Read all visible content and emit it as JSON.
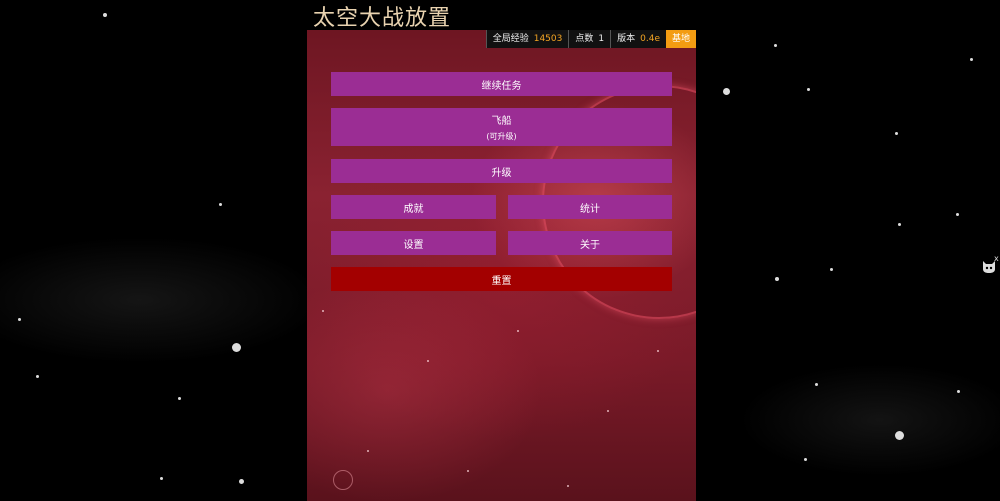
{
  "title": "太空大战放置",
  "topbar": {
    "global_xp_label": "全局经验",
    "global_xp_value": "14503",
    "points_label": "点数",
    "points_value": "1",
    "version_label": "版本",
    "version_value": "0.4e",
    "base_label": "基地"
  },
  "menu": {
    "continue_mission": "继续任务",
    "ship": "飞船",
    "ship_sub": "(可升级)",
    "upgrade": "升级",
    "achievements": "成就",
    "statistics": "统计",
    "settings": "设置",
    "about": "关于",
    "reset": "重置"
  },
  "colors": {
    "button": "#9b2d94",
    "reset_button": "#a30000",
    "accent": "#f39c12",
    "title": "#e9d3b0"
  },
  "icons": {
    "side_widget": "cat-icon",
    "side_close": "close-icon"
  }
}
